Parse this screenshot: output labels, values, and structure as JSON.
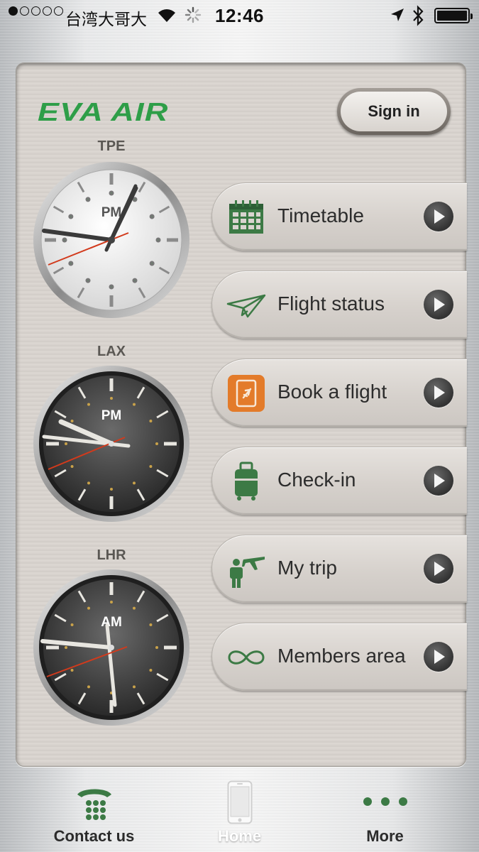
{
  "status_bar": {
    "carrier": "台湾大哥大",
    "time": "12:46",
    "icons": [
      "signal-dots",
      "wifi-icon",
      "activity-spinner-icon",
      "location-arrow-icon",
      "bluetooth-icon",
      "battery-icon"
    ]
  },
  "header": {
    "logo_text": "EVA AIR",
    "sign_in_label": "Sign in"
  },
  "clocks": [
    {
      "city": "TPE",
      "period": "PM",
      "style": "light"
    },
    {
      "city": "LAX",
      "period": "PM",
      "style": "dark"
    },
    {
      "city": "LHR",
      "period": "AM",
      "style": "dark"
    }
  ],
  "menu": [
    {
      "label": "Timetable",
      "icon": "calendar-icon"
    },
    {
      "label": "Flight status",
      "icon": "paper-plane-icon"
    },
    {
      "label": "Book a flight",
      "icon": "booking-icon"
    },
    {
      "label": "Check-in",
      "icon": "luggage-icon"
    },
    {
      "label": "My trip",
      "icon": "traveler-plane-icon"
    },
    {
      "label": "Members area",
      "icon": "infinity-icon"
    }
  ],
  "tabbar": {
    "contact": "Contact us",
    "home": "Home",
    "more": "More"
  },
  "colors": {
    "brand_green": "#2e9e48",
    "icon_green": "#3c7a45",
    "booking_orange": "#e37b2a",
    "clock_second_hand": "#d23a1c"
  }
}
